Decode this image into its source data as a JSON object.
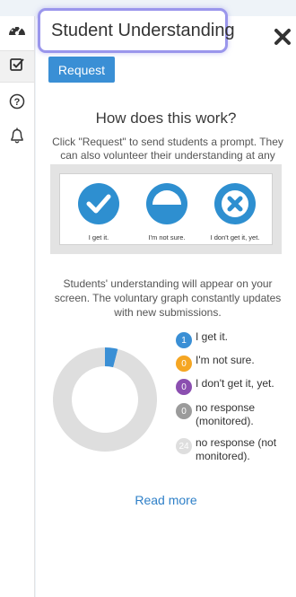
{
  "sidebar": {
    "items": [
      {
        "icon": "dashboard-icon"
      },
      {
        "icon": "checkbox-icon"
      },
      {
        "icon": "help-icon"
      },
      {
        "icon": "bell-icon"
      }
    ]
  },
  "panel": {
    "title": "Student Understanding",
    "request_label": "Request",
    "close_icon": "close-icon",
    "heading": "How does this work?",
    "intro": "Click \"Request\" to send students a prompt. They can also volunteer their understanding at any time.",
    "demo_options": [
      {
        "label": "I get it.",
        "icon": "check-circle-icon",
        "color": "#2e8fd0"
      },
      {
        "label": "I'm not sure.",
        "icon": "half-circle-icon",
        "color": "#2e8fd0"
      },
      {
        "label": "I don't get it, yet.",
        "icon": "x-circle-icon",
        "color": "#2e8fd0"
      }
    ],
    "info": "Students' understanding will appear on your screen. The voluntary graph constantly updates with new submissions.",
    "read_more": "Read more"
  },
  "legend": [
    {
      "count": "1",
      "label": "I get it.",
      "color": "#3a8fd5"
    },
    {
      "count": "0",
      "label": "I'm not sure.",
      "color": "#f5a623"
    },
    {
      "count": "0",
      "label": "I don't get it, yet.",
      "color": "#8b4fb0"
    },
    {
      "count": "0",
      "label": "no response (monitored).",
      "color": "#9b9b9b"
    },
    {
      "count": "24",
      "label": "no response (not monitored).",
      "color": "#dedede"
    }
  ],
  "chart_data": {
    "type": "pie",
    "categories": [
      "I get it.",
      "I'm not sure.",
      "I don't get it, yet.",
      "no response (monitored).",
      "no response (not monitored)."
    ],
    "values": [
      1,
      0,
      0,
      0,
      24
    ],
    "colors": [
      "#3a8fd5",
      "#f5a623",
      "#8b4fb0",
      "#9b9b9b",
      "#dedede"
    ]
  }
}
